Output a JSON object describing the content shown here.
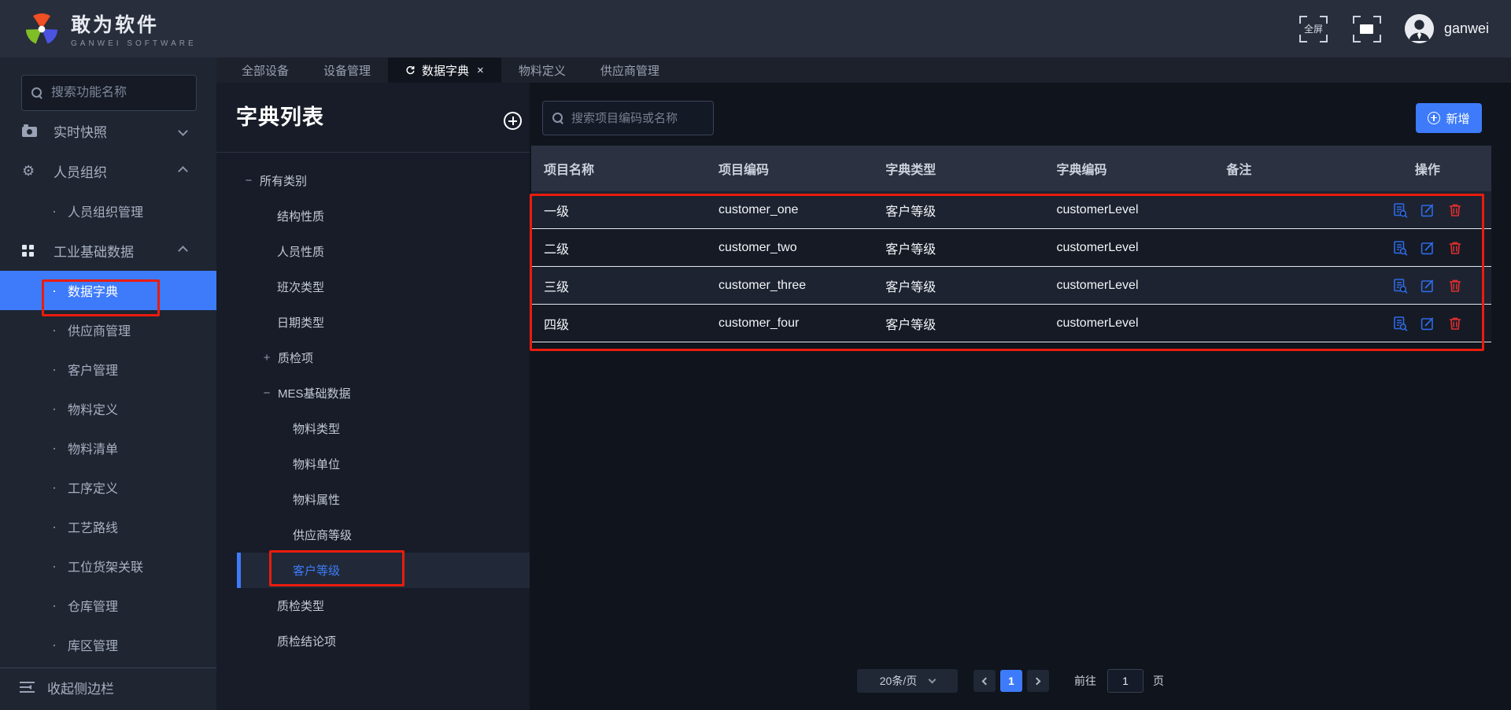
{
  "header": {
    "logo_title": "敢为软件",
    "logo_subtitle": "GANWEI  SOFTWARE",
    "fullscreen_cn_label": "全屏",
    "username": "ganwei"
  },
  "tabs": [
    {
      "label": "全部设备",
      "active": false
    },
    {
      "label": "设备管理",
      "active": false
    },
    {
      "label": "数据字典",
      "active": true
    },
    {
      "label": "物料定义",
      "active": false
    },
    {
      "label": "供应商管理",
      "active": false
    }
  ],
  "icons": {
    "close_glyph": "×",
    "bullet_glyph": "·",
    "gear_glyph": "⚙"
  },
  "sidebar": {
    "search_placeholder": "搜索功能名称",
    "groups": [
      {
        "label": "实时快照",
        "icon": "camera-icon",
        "chevron": "down",
        "children": []
      },
      {
        "label": "人员组织",
        "icon": "gear-icon",
        "chevron": "up",
        "children": [
          "人员组织管理"
        ]
      },
      {
        "label": "工业基础数据",
        "icon": "grid-icon",
        "chevron": "up",
        "children": [
          "数据字典",
          "供应商管理",
          "客户管理",
          "物料定义",
          "物料清单",
          "工序定义",
          "工艺路线",
          "工位货架关联",
          "仓库管理",
          "库区管理"
        ],
        "active_child": "数据字典"
      }
    ],
    "collapse_label": "收起侧边栏"
  },
  "tree_panel": {
    "title": "字典列表",
    "nodes": [
      {
        "label": "所有类别",
        "expander": "−"
      },
      {
        "label": "结构性质"
      },
      {
        "label": "人员性质"
      },
      {
        "label": "班次类型"
      },
      {
        "label": "日期类型"
      },
      {
        "label": "质检项",
        "expander": "+"
      },
      {
        "label": "MES基础数据",
        "expander": "−"
      },
      {
        "label": "物料类型"
      },
      {
        "label": "物料单位"
      },
      {
        "label": "物料属性"
      },
      {
        "label": "供应商等级"
      },
      {
        "label": "客户等级",
        "selected": true
      },
      {
        "label": "质检类型"
      },
      {
        "label": "质检结论项"
      }
    ]
  },
  "main": {
    "search_placeholder": "搜索项目编码或名称",
    "add_button_label": "新增",
    "table": {
      "columns": [
        "项目名称",
        "项目编码",
        "字典类型",
        "字典编码",
        "备注",
        "操作"
      ],
      "rows": [
        {
          "name": "一级",
          "code": "customer_one",
          "dict_type": "客户等级",
          "dict_code": "customerLevel",
          "note": ""
        },
        {
          "name": "二级",
          "code": "customer_two",
          "dict_type": "客户等级",
          "dict_code": "customerLevel",
          "note": ""
        },
        {
          "name": "三级",
          "code": "customer_three",
          "dict_type": "客户等级",
          "dict_code": "customerLevel",
          "note": ""
        },
        {
          "name": "四级",
          "code": "customer_four",
          "dict_type": "客户等级",
          "dict_code": "customerLevel",
          "note": ""
        }
      ]
    },
    "pagination": {
      "page_size_label": "20条/页",
      "current_page": "1",
      "goto_label": "前往",
      "goto_value": "1",
      "page_unit_label": "页"
    }
  },
  "colors": {
    "accent_blue": "#3d7bfa",
    "annotation_red": "#ea1c0d",
    "danger_red": "#e02f2f",
    "op_icon_blue": "#2e6be6",
    "header_bg": "#282e3b",
    "sidebar_bg": "#1f2531",
    "content_bg": "#10141d",
    "table_header_bg": "#2b3140"
  }
}
